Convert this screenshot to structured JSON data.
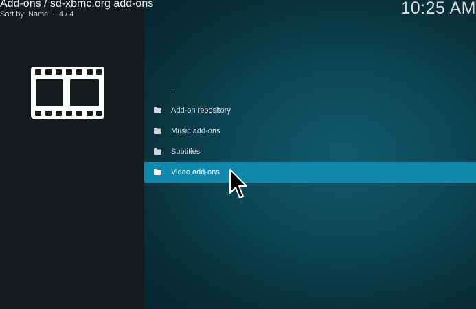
{
  "header": {
    "title": "Add-ons / sd-xbmc.org add-ons",
    "sort_label": "Sort by: Name",
    "count": "4 / 4"
  },
  "clock": "10:25 AM",
  "thumbnail_icon": "film-strip-icon",
  "list": {
    "items": [
      {
        "label": "..",
        "icon": ""
      },
      {
        "label": "Add-on repository",
        "icon": "folder-icon"
      },
      {
        "label": "Music add-ons",
        "icon": "folder-icon"
      },
      {
        "label": "Subtitles",
        "icon": "folder-icon"
      },
      {
        "label": "Video add-ons",
        "icon": "folder-icon",
        "selected": true
      }
    ]
  },
  "colors": {
    "accent": "#1189ad",
    "left_panel": "#151a1d",
    "background": "#0c4656"
  }
}
